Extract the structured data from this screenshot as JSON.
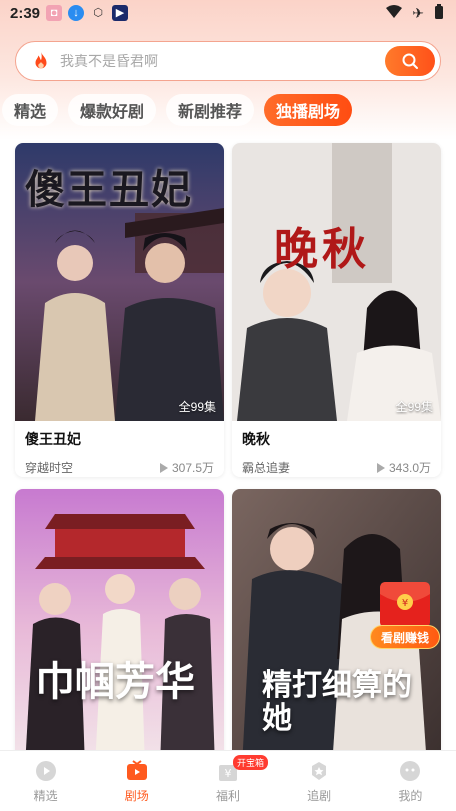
{
  "status_bar": {
    "time": "2:39"
  },
  "search": {
    "placeholder": "我真不是昏君啊"
  },
  "tabs": [
    {
      "label": "精选",
      "active": false
    },
    {
      "label": "爆款好剧",
      "active": false
    },
    {
      "label": "新剧推荐",
      "active": false
    },
    {
      "label": "独播剧场",
      "active": true
    }
  ],
  "cards": [
    {
      "title": "傻王丑妃",
      "tag": "穿越时空",
      "plays": "307.5万",
      "episodes": "全99集",
      "poster_title": "傻王丑妃"
    },
    {
      "title": "晚秋",
      "tag": "霸总追妻",
      "plays": "343.0万",
      "episodes": "全99集",
      "poster_title": "晚秋"
    },
    {
      "title": "",
      "tag": "",
      "plays": "",
      "episodes": "",
      "poster_title": "巾帼芳华"
    },
    {
      "title": "",
      "tag": "",
      "plays": "",
      "episodes": "",
      "poster_title": "精打细算的她"
    }
  ],
  "promo": {
    "label": "看剧赚钱"
  },
  "bottom_nav": [
    {
      "label": "精选",
      "icon": "play-circle-icon",
      "active": false
    },
    {
      "label": "剧场",
      "icon": "tv-icon",
      "active": true
    },
    {
      "label": "福利",
      "icon": "gift-icon",
      "active": false,
      "badge": "开宝箱"
    },
    {
      "label": "追剧",
      "icon": "star-icon",
      "active": false
    },
    {
      "label": "我的",
      "icon": "face-icon",
      "active": false
    }
  ],
  "colors": {
    "accent": "#ff5a1f",
    "search_border": "#f4a48f"
  }
}
